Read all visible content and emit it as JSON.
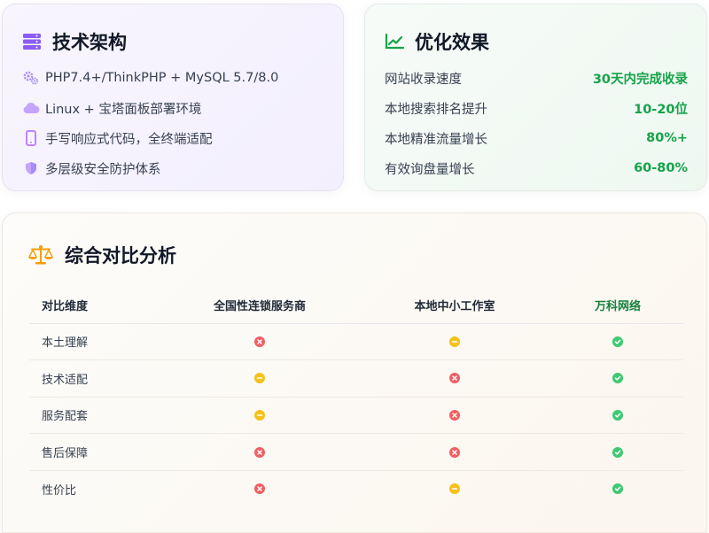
{
  "tech_card": {
    "title": "技术架构",
    "icon": "server-icon",
    "accent": "#8b5cf6",
    "items": [
      {
        "icon": "gears-icon",
        "text": "PHP7.4+/ThinkPHP + MySQL 5.7/8.0"
      },
      {
        "icon": "cloud-icon",
        "text": "Linux + 宝塔面板部署环境"
      },
      {
        "icon": "mobile-icon",
        "text": "手写响应式代码，全终端适配"
      },
      {
        "icon": "shield-icon",
        "text": "多层级安全防护体系"
      }
    ]
  },
  "effect_card": {
    "title": "优化效果",
    "icon": "chart-line-icon",
    "accent": "#16a34a",
    "items": [
      {
        "label": "网站收录速度",
        "value": "30天内完成收录"
      },
      {
        "label": "本地搜索排名提升",
        "value": "10-20位"
      },
      {
        "label": "本地精准流量增长",
        "value": "80%+"
      },
      {
        "label": "有效询盘量增长",
        "value": "60-80%"
      }
    ]
  },
  "compare_card": {
    "title": "综合对比分析",
    "icon": "balance-scale-icon",
    "accent": "#f59e0b",
    "headers": [
      "对比维度",
      "全国性连锁服务商",
      "本地中小工作室",
      "万科网络"
    ],
    "rows": [
      {
        "dimension": "本土理解",
        "marks": [
          "bad",
          "mid",
          "good"
        ]
      },
      {
        "dimension": "技术适配",
        "marks": [
          "mid",
          "bad",
          "good"
        ]
      },
      {
        "dimension": "服务配套",
        "marks": [
          "mid",
          "bad",
          "good"
        ]
      },
      {
        "dimension": "售后保障",
        "marks": [
          "bad",
          "bad",
          "good"
        ]
      },
      {
        "dimension": "性价比",
        "marks": [
          "bad",
          "mid",
          "good"
        ]
      }
    ],
    "mark_colors": {
      "bad": "#ef5f63",
      "mid": "#f5c21b",
      "good": "#3fc971"
    }
  }
}
